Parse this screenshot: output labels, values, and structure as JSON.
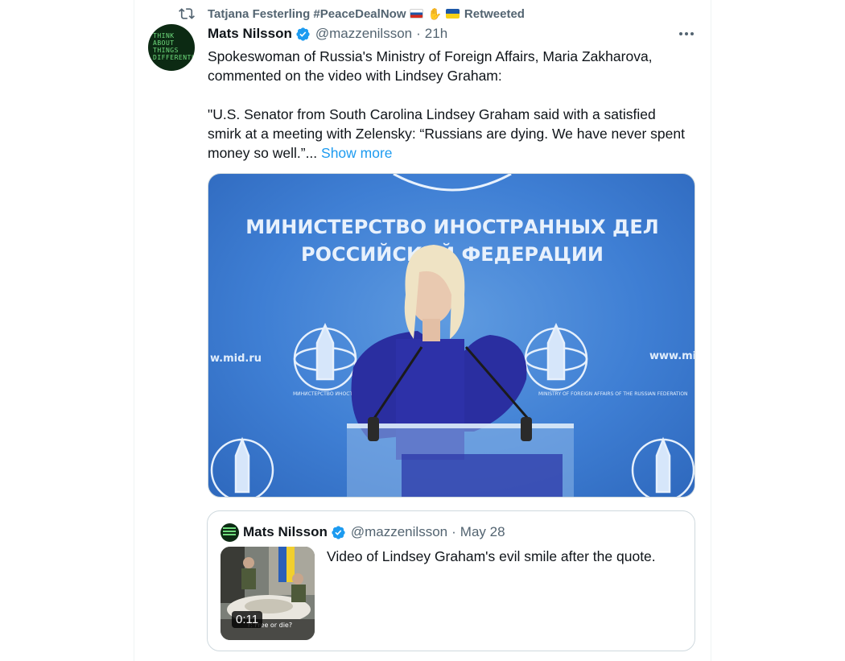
{
  "retweet": {
    "retweeter_name": "Tatjana Festerling #PeaceDealNow",
    "label": "Retweeted"
  },
  "avatar": {
    "lines": [
      "THINK",
      "ABOUT",
      "THINGS",
      "DIFFERENTLY"
    ]
  },
  "tweet": {
    "author_name": "Mats Nilsson",
    "handle": "@mazzenilsson",
    "separator": "·",
    "time": "21h",
    "text_line_1": "Spokeswoman of Russia's Ministry of Foreign Affairs, Maria Zakharova, commented on the video with Lindsey Graham:",
    "text_line_2": "\"U.S. Senator from South Carolina Lindsey Graham said with a satisfied smirk at a meeting with Zelensky: “Russians are dying. We have never spent money so well.”...",
    "show_more": "Show more"
  },
  "media": {
    "banner_line_1": "МИНИСТЕРСТВО ИНОСТРАННЫХ ДЕЛ",
    "banner_line_2": "РОССИЙСКОЙ ФЕДЕРАЦИИ",
    "site_left": "w.mid.ru",
    "site_right": "www.mid",
    "logo_caption_left": "МИНИСТЕРСТВО ИНОСТРАННЫХ ДЕЛ РОССИЙСКОЙ ФЕДЕ",
    "logo_caption_right": "MINISTRY OF FOREIGN AFFAIRS OF THE RUSSIAN FEDERATION"
  },
  "quote": {
    "author_name": "Mats Nilsson",
    "handle": "@mazzenilsson",
    "separator": "·",
    "time": "May 28",
    "text": "Video of Lindsey Graham's evil smile after the quote.",
    "video_duration": "0:11",
    "video_caption": "r: Free or die?"
  },
  "colors": {
    "accent": "#1d9bf0",
    "secondary_text": "#536471",
    "border": "#cfd9de"
  }
}
